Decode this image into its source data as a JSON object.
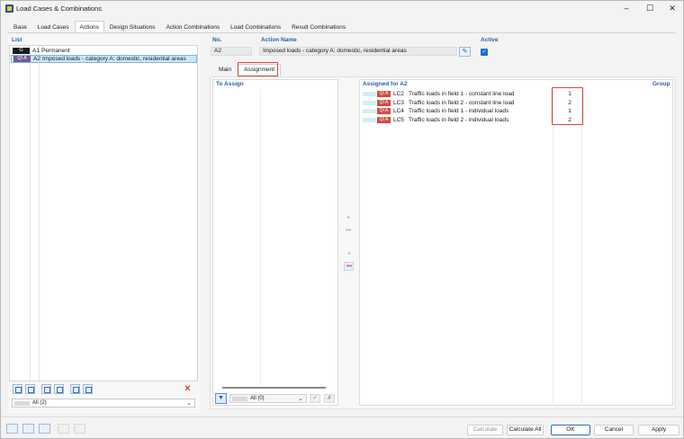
{
  "window": {
    "title": "Load Cases & Combinations",
    "minimize": "–",
    "maximize": "☐",
    "close": "✕"
  },
  "top_tabs": [
    {
      "label": "Base"
    },
    {
      "label": "Load Cases"
    },
    {
      "label": "Actions",
      "active": true
    },
    {
      "label": "Design Situations"
    },
    {
      "label": "Action Combinations"
    },
    {
      "label": "Load Combinations"
    },
    {
      "label": "Result Combinations"
    }
  ],
  "list": {
    "label": "List",
    "items": [
      {
        "badge": "G",
        "id": "A1",
        "name": "Permanent"
      },
      {
        "badge": "QI A",
        "id": "A2",
        "name": "Imposed loads - category A: domestic, residential areas",
        "selected": true
      }
    ],
    "filter": "All (2)"
  },
  "header": {
    "no_label": "No.",
    "no_value": "A2",
    "action_name_label": "Action Name",
    "action_name_value": "Imposed loads - category A: domestic, residential areas",
    "active_label": "Active",
    "active_checked": "✓"
  },
  "sub_tabs": [
    {
      "label": "Main"
    },
    {
      "label": "Assignment",
      "active": true
    }
  ],
  "to_assign": {
    "label": "To Assign",
    "filter": "All (0)"
  },
  "assigned": {
    "label": "Assigned for A2",
    "group_label": "Group",
    "rows": [
      {
        "badge": "QI A",
        "id": "LC2",
        "name": "Traffic loads in field 1 - constant line load",
        "group": "1"
      },
      {
        "badge": "QI A",
        "id": "LC3",
        "name": "Traffic loads in field 2 - constant line load",
        "group": "2"
      },
      {
        "badge": "QI A",
        "id": "LC4",
        "name": "Traffic loads in field 1 - individual loads",
        "group": "1"
      },
      {
        "badge": "QI A",
        "id": "LC5",
        "name": "Traffic loads in field 2 - individual loads",
        "group": "2"
      }
    ]
  },
  "transfer_buttons": {
    "add_one": "▸",
    "add_all": "▸▸",
    "remove_one": "◂",
    "remove_all": "◂◂"
  },
  "footer": {
    "calculate": "Calculate",
    "calculate_all": "Calculate All",
    "ok": "OK",
    "cancel": "Cancel",
    "apply": "Apply"
  },
  "colors": {
    "accent_blue": "#2a5db0",
    "highlight_red": "#d9423a",
    "badge_qia": "#d14a43",
    "badge_q_list": "#6f5b9a",
    "selection": "#cde6fa"
  }
}
